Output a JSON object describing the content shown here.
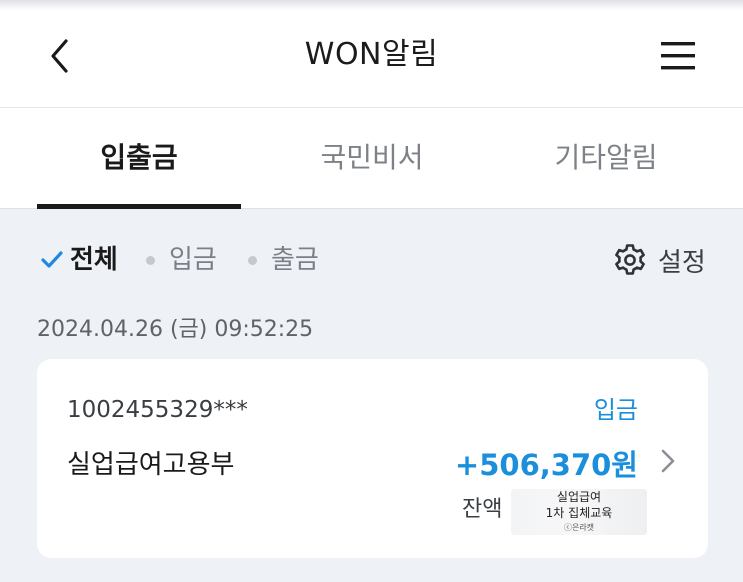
{
  "header": {
    "title": "WON알림",
    "back_icon": "chevron-left-icon",
    "menu_icon": "hamburger-menu-icon"
  },
  "tabs": [
    {
      "label": "입출금",
      "active": true
    },
    {
      "label": "국민비서",
      "active": false
    },
    {
      "label": "기타알림",
      "active": false
    }
  ],
  "filters": {
    "items": [
      {
        "label": "전체",
        "selected": true
      },
      {
        "label": "입금",
        "selected": false
      },
      {
        "label": "출금",
        "selected": false
      }
    ],
    "settings_label": "설정",
    "settings_icon": "gear-icon"
  },
  "notifications": [
    {
      "timestamp": "2024.04.26 (금) 09:52:25",
      "account": "1002455329***",
      "type": "입금",
      "description": "실업급여고용부",
      "amount": "+506,370원",
      "balance_label": "잔액",
      "balance_mask": {
        "line1": "실업급여",
        "line2": "1차 집체교육",
        "line3": "ⓒ은라캣"
      }
    }
  ],
  "colors": {
    "accent_blue": "#1c8fdc",
    "page_background": "#eef1f5",
    "check_blue": "#1e88e5"
  }
}
